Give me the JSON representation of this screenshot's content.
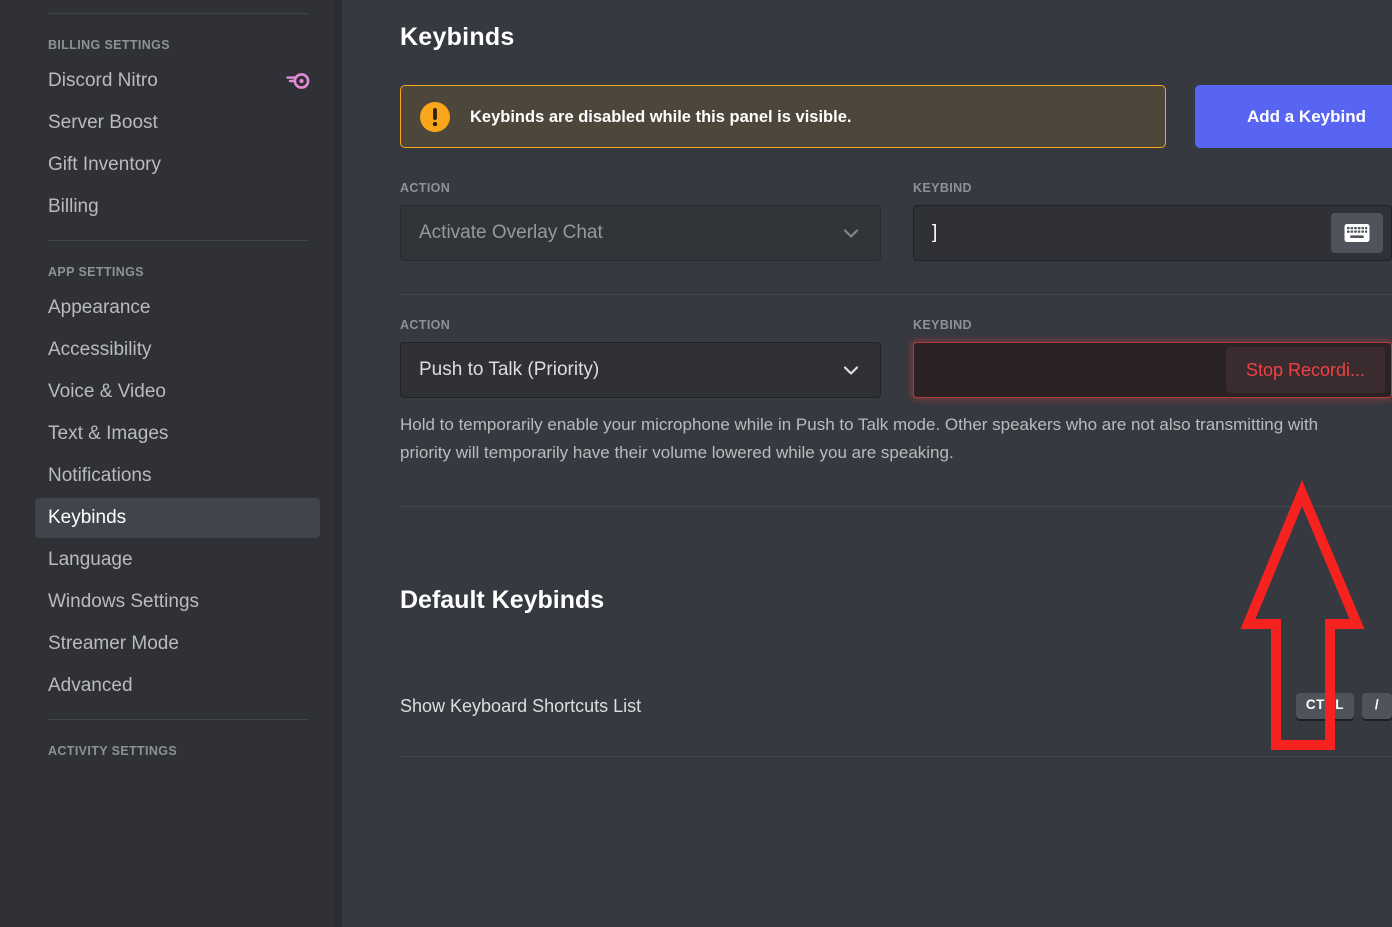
{
  "sidebar": {
    "sections": [
      {
        "header": "BILLING SETTINGS",
        "items": [
          {
            "label": "Discord Nitro",
            "icon": "nitro-boost-icon",
            "active": false
          },
          {
            "label": "Server Boost",
            "icon": null,
            "active": false
          },
          {
            "label": "Gift Inventory",
            "icon": null,
            "active": false
          },
          {
            "label": "Billing",
            "icon": null,
            "active": false
          }
        ]
      },
      {
        "header": "APP SETTINGS",
        "items": [
          {
            "label": "Appearance",
            "icon": null,
            "active": false
          },
          {
            "label": "Accessibility",
            "icon": null,
            "active": false
          },
          {
            "label": "Voice & Video",
            "icon": null,
            "active": false
          },
          {
            "label": "Text & Images",
            "icon": null,
            "active": false
          },
          {
            "label": "Notifications",
            "icon": null,
            "active": false
          },
          {
            "label": "Keybinds",
            "icon": null,
            "active": true
          },
          {
            "label": "Language",
            "icon": null,
            "active": false
          },
          {
            "label": "Windows Settings",
            "icon": null,
            "active": false
          },
          {
            "label": "Streamer Mode",
            "icon": null,
            "active": false
          },
          {
            "label": "Advanced",
            "icon": null,
            "active": false
          }
        ]
      },
      {
        "header": "ACTIVITY SETTINGS",
        "items": []
      }
    ]
  },
  "main": {
    "title": "Keybinds",
    "notice": {
      "icon": "warning-icon",
      "text": "Keybinds are disabled while this panel is visible."
    },
    "add_keybind_label": "Add a Keybind",
    "labels": {
      "action": "ACTION",
      "keybind": "KEYBIND"
    },
    "keybind_rows": [
      {
        "action_value": "Activate Overlay Chat",
        "action_disabled": true,
        "keybind_value": "]",
        "recording": false,
        "record_button_icon": "keyboard-icon",
        "description": ""
      },
      {
        "action_value": "Push to Talk (Priority)",
        "action_disabled": false,
        "keybind_value": "",
        "recording": true,
        "record_button_label": "Stop Recordi...",
        "description": "Hold to temporarily enable your microphone while in Push to Talk mode. Other speakers who are not also transmitting with priority will temporarily have their volume lowered while you are speaking."
      }
    ],
    "default_section": {
      "title": "Default Keybinds",
      "shortcuts": [
        {
          "name": "Show Keyboard Shortcuts List",
          "keys": [
            "CTRL",
            "/"
          ]
        }
      ]
    }
  },
  "annotation": {
    "type": "arrow-up",
    "color": "#f5221f"
  },
  "colors": {
    "sidebar_bg": "#2f3136",
    "content_bg": "#36393f",
    "accent_blurple": "#5865f2",
    "warning": "#faa61a",
    "danger": "#ed4245",
    "nitro_pink": "#e48bd8"
  }
}
